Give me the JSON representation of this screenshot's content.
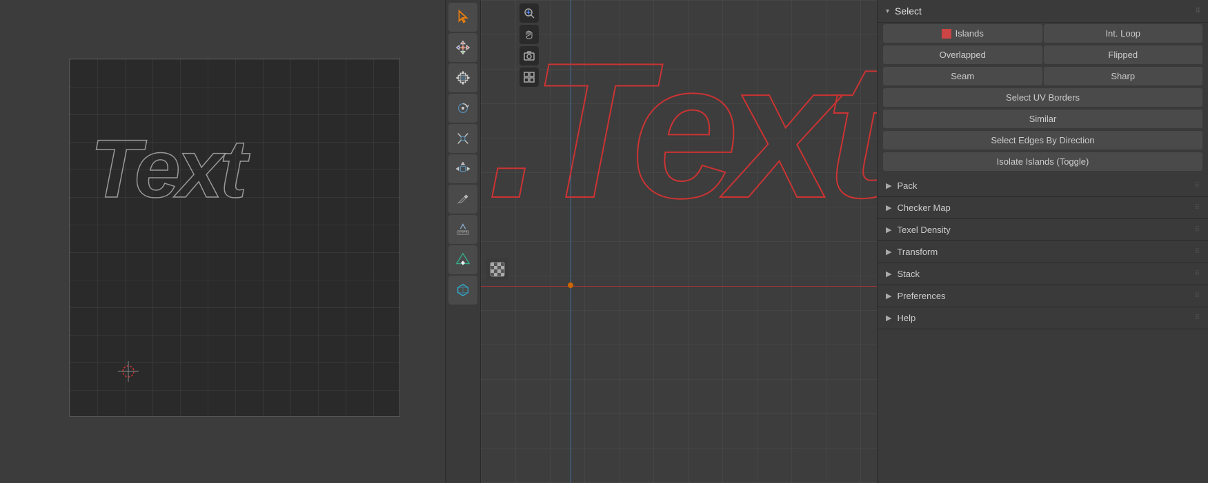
{
  "left_panel": {
    "viewport_text": "Text"
  },
  "right_panel": {
    "select_section": {
      "title": "Select",
      "buttons_row1": [
        {
          "label": "Islands",
          "id": "islands"
        },
        {
          "label": "Int. Loop",
          "id": "int-loop"
        }
      ],
      "buttons_row2": [
        {
          "label": "Overlapped",
          "id": "overlapped"
        },
        {
          "label": "Flipped",
          "id": "flipped"
        }
      ],
      "buttons_row3": [
        {
          "label": "Seam",
          "id": "seam"
        },
        {
          "label": "Sharp",
          "id": "sharp"
        }
      ],
      "button_uv_borders": "Select UV Borders",
      "button_similar": "Similar",
      "button_edges_direction": "Select Edges By Direction",
      "button_isolate": "Isolate Islands (Toggle)"
    },
    "sections": [
      {
        "title": "Pack",
        "id": "pack"
      },
      {
        "title": "Checker Map",
        "id": "checker-map"
      },
      {
        "title": "Texel Density",
        "id": "texel-density"
      },
      {
        "title": "Transform",
        "id": "transform"
      },
      {
        "title": "Stack",
        "id": "stack"
      },
      {
        "title": "Preferences",
        "id": "preferences"
      },
      {
        "title": "Help",
        "id": "help"
      }
    ]
  },
  "uv_editor": {
    "text": ".Text"
  },
  "toolbar": {
    "tools": [
      {
        "icon": "cursor",
        "label": "Cursor"
      },
      {
        "icon": "move",
        "label": "Move"
      },
      {
        "icon": "pan",
        "label": "Pan"
      },
      {
        "icon": "rotate",
        "label": "Rotate"
      },
      {
        "icon": "scale",
        "label": "Scale"
      },
      {
        "icon": "transform",
        "label": "Transform"
      },
      {
        "icon": "annotate",
        "label": "Annotate"
      },
      {
        "icon": "measure",
        "label": "Measure"
      },
      {
        "icon": "add",
        "label": "Add"
      },
      {
        "icon": "cube",
        "label": "Cube"
      }
    ]
  }
}
